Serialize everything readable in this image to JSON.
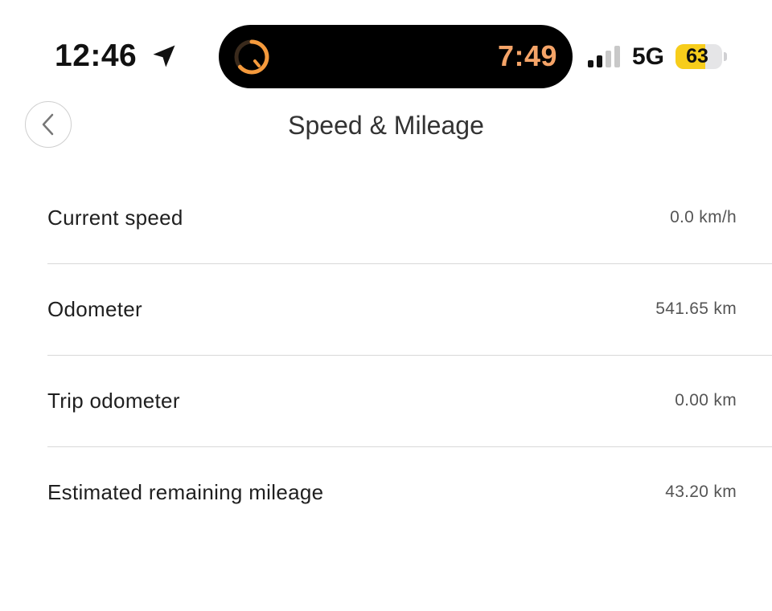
{
  "status_bar": {
    "time": "12:46",
    "timer": "7:49",
    "network": "5G",
    "battery_level": "63",
    "battery_fraction": 0.63
  },
  "icons": {
    "location": "location-arrow-icon",
    "timer": "timer-ring-icon",
    "signal": "signal-bars-icon",
    "back": "chevron-left-icon"
  },
  "colors": {
    "timer_accent": "#f5a468",
    "battery_fill": "#f7cd1b"
  },
  "header": {
    "title": "Speed & Mileage"
  },
  "rows": [
    {
      "label": "Current speed",
      "value": "0.0 km/h"
    },
    {
      "label": "Odometer",
      "value": "541.65 km"
    },
    {
      "label": "Trip odometer",
      "value": "0.00 km"
    },
    {
      "label": "Estimated remaining mileage",
      "value": "43.20 km"
    }
  ]
}
